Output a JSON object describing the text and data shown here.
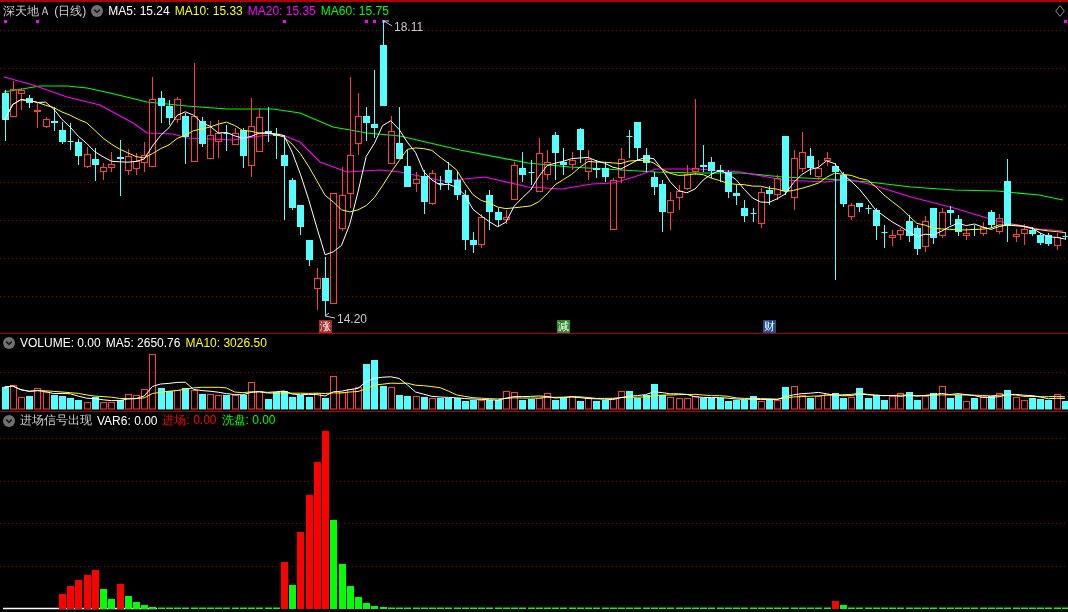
{
  "main_chart": {
    "title": "深天地Ａ (日线)",
    "legend": [
      {
        "label": "MA5: 15.24",
        "color": "#ffffff"
      },
      {
        "label": "MA10: 15.33",
        "color": "#ffff00"
      },
      {
        "label": "MA20: 15.35",
        "color": "#ff00ff"
      },
      {
        "label": "MA60: 15.75",
        "color": "#00ff00"
      }
    ],
    "high_label": "18.11",
    "low_label": "14.20",
    "signal_markers": [
      {
        "label": "涨",
        "color": "#a52a2a"
      },
      {
        "label": "减",
        "color": "#2e8b2e"
      },
      {
        "label": "财",
        "color": "#1f4f8f"
      }
    ]
  },
  "volume_chart": {
    "legend": [
      {
        "label": "VOLUME: 0.00",
        "color": "#ffffff"
      },
      {
        "label": "MA5: 2650.76",
        "color": "#ffffff"
      },
      {
        "label": "MA10: 3026.50",
        "color": "#ffff00"
      }
    ]
  },
  "indicator_chart": {
    "title": "进场信号出现",
    "legend": [
      {
        "label": "VAR6: 0.00",
        "color": "#ffffff"
      },
      {
        "label": "进场: 0.00",
        "color": "#ff0000"
      },
      {
        "label": "洗盘: 0.00",
        "color": "#00ff00"
      }
    ]
  }
}
